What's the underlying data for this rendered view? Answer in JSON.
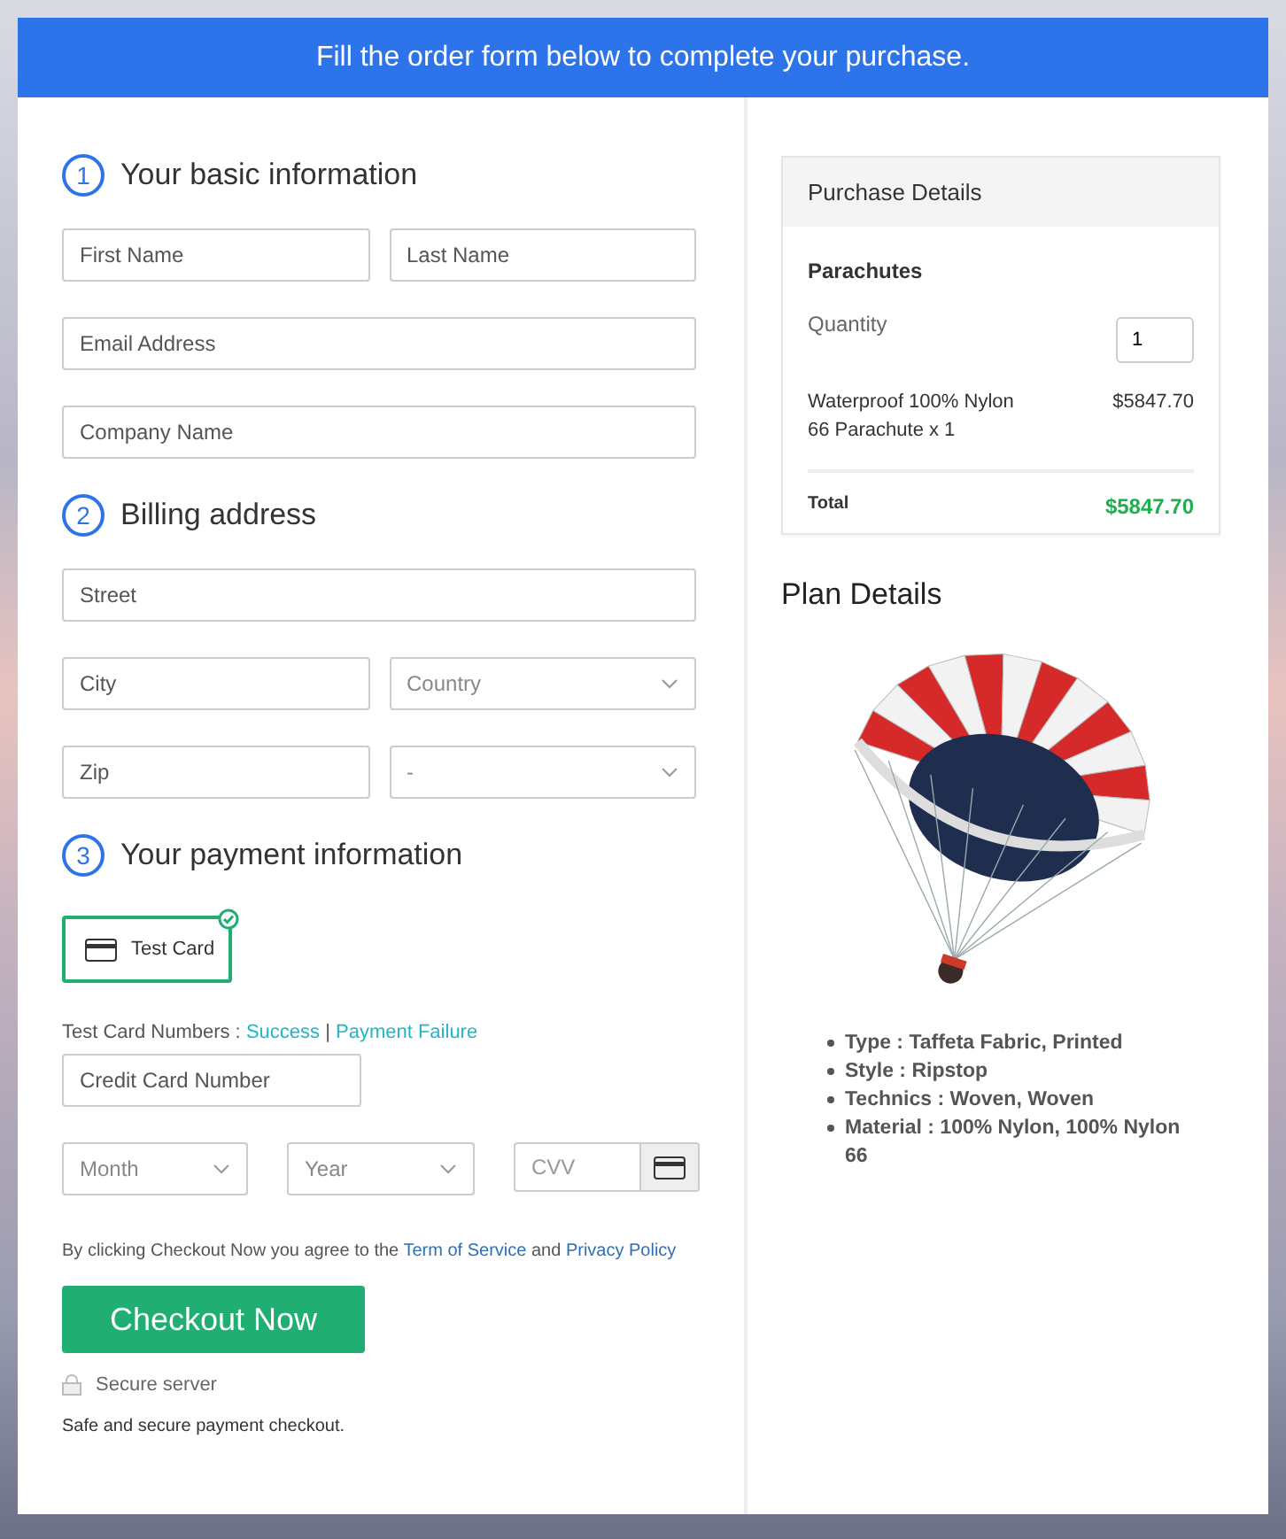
{
  "header": {
    "text": "Fill the order form below to complete your purchase."
  },
  "sections": [
    {
      "number": "1",
      "title": "Your basic information",
      "rows": [
        [
          {
            "kind": "input",
            "placeholder": "First Name"
          },
          {
            "kind": "input",
            "placeholder": "Last Name"
          }
        ],
        [
          {
            "kind": "input",
            "placeholder": "Email Address"
          }
        ],
        [
          {
            "kind": "input",
            "placeholder": "Company Name"
          }
        ]
      ]
    },
    {
      "number": "2",
      "title": "Billing address",
      "rows": [
        [
          {
            "kind": "input",
            "placeholder": "Street"
          }
        ],
        [
          {
            "kind": "input",
            "placeholder": "City"
          },
          {
            "kind": "select",
            "placeholder": "Country"
          }
        ],
        [
          {
            "kind": "input",
            "placeholder": "Zip"
          },
          {
            "kind": "select",
            "placeholder": "-"
          }
        ]
      ]
    }
  ],
  "payment": {
    "number": "3",
    "title": "Your payment information",
    "methods": [
      {
        "label": "Test Card",
        "selected": true
      }
    ],
    "test_numbers": {
      "label": "Test Card Numbers :",
      "links": [
        "Success",
        "Payment Failure"
      ],
      "separator": "|"
    },
    "card_number": {
      "placeholder": "Credit Card Number"
    },
    "month": {
      "placeholder": "Month"
    },
    "year": {
      "placeholder": "Year"
    },
    "cvv": {
      "placeholder": "CVV"
    }
  },
  "agreement": {
    "text": "By clicking Checkout Now you agree to the",
    "links": [
      "Term of Service",
      "Privacy Policy"
    ],
    "joiner": "and"
  },
  "checkout_button": "Checkout Now",
  "secure_server": "Secure server",
  "safe_note": "Safe and secure payment checkout.",
  "purchase": {
    "title": "Purchase Details",
    "product": "Parachutes",
    "quantity_label": "Quantity",
    "quantity": "1",
    "item": "Waterproof 100% Nylon 66 Parachute x 1",
    "item_price": "$5847.70",
    "total_label": "Total",
    "total": "$5847.70"
  },
  "plan": {
    "title": "Plan Details",
    "features": [
      "Type : Taffeta Fabric, Printed",
      "Style : Ripstop",
      "Technics : Woven, Woven",
      "Material : 100% Nylon, 100% Nylon 66"
    ]
  }
}
